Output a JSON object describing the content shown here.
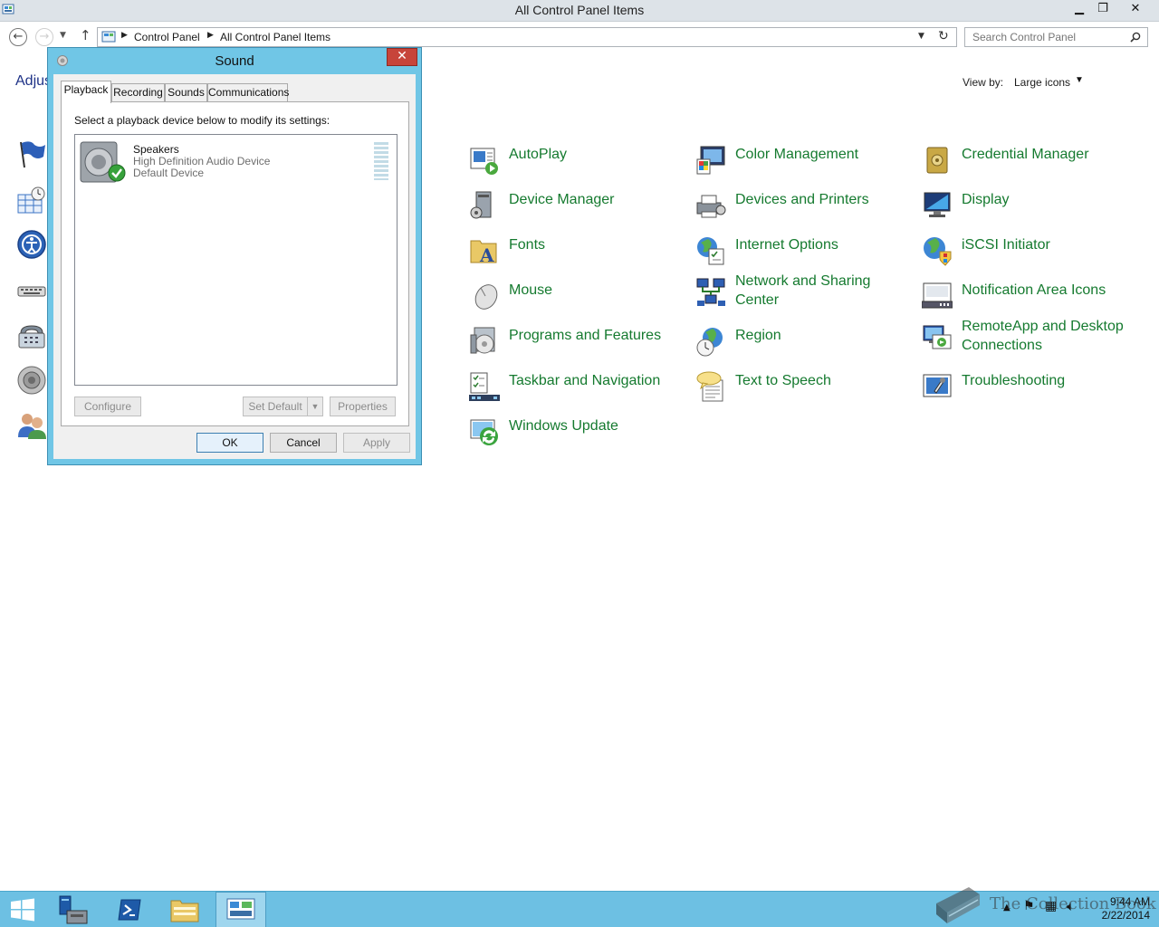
{
  "window": {
    "title": "All Control Panel Items",
    "controls": {
      "minimize": "▁",
      "restore": "❐",
      "close": "✕"
    }
  },
  "address_bar": {
    "breadcrumbs": [
      "Control Panel",
      "All Control Panel Items"
    ]
  },
  "search": {
    "placeholder": "Search Control Panel"
  },
  "content": {
    "heading": "Adjus",
    "view_by": {
      "label": "View by:",
      "value": "Large icons"
    },
    "items": [
      {
        "label": "AutoPlay",
        "icon": "autoplay-icon"
      },
      {
        "label": "Color Management",
        "icon": "color-management-icon"
      },
      {
        "label": "Credential Manager",
        "icon": "credential-manager-icon"
      },
      {
        "label": "Device Manager",
        "icon": "device-manager-icon"
      },
      {
        "label": "Devices and Printers",
        "icon": "devices-printers-icon"
      },
      {
        "label": "Display",
        "icon": "display-icon"
      },
      {
        "label": "Fonts",
        "icon": "fonts-icon"
      },
      {
        "label": "Internet Options",
        "icon": "internet-options-icon"
      },
      {
        "label": "iSCSI Initiator",
        "icon": "iscsi-icon"
      },
      {
        "label": "Mouse",
        "icon": "mouse-icon"
      },
      {
        "label": "Network and Sharing Center",
        "icon": "network-icon"
      },
      {
        "label": "Notification Area Icons",
        "icon": "notification-icon"
      },
      {
        "label": "Programs and Features",
        "icon": "programs-icon"
      },
      {
        "label": "Region",
        "icon": "region-icon"
      },
      {
        "label": "RemoteApp and Desktop Connections",
        "icon": "remoteapp-icon"
      },
      {
        "label": "Taskbar and Navigation",
        "icon": "taskbar-nav-icon"
      },
      {
        "label": "Text to Speech",
        "icon": "text-to-speech-icon"
      },
      {
        "label": "Troubleshooting",
        "icon": "troubleshooting-icon"
      },
      {
        "label": "Windows Update",
        "icon": "windows-update-icon"
      }
    ]
  },
  "sound_dialog": {
    "title": "Sound",
    "close": "✕",
    "tabs": [
      "Playback",
      "Recording",
      "Sounds",
      "Communications"
    ],
    "active_tab": "Playback",
    "instructions": "Select a playback device below to modify its settings:",
    "device": {
      "name": "Speakers",
      "description": "High Definition Audio Device",
      "status": "Default Device"
    },
    "buttons": {
      "configure": "Configure",
      "set_default": "Set Default",
      "properties": "Properties",
      "ok": "OK",
      "cancel": "Cancel",
      "apply": "Apply"
    }
  },
  "taskbar": {
    "items": [
      "start-icon",
      "server-manager-icon",
      "powershell-icon",
      "file-explorer-icon",
      "control-panel-icon"
    ],
    "time": "9:44 AM",
    "date": "2/22/2014"
  },
  "watermark": {
    "text": "The Collection Book"
  },
  "colors": {
    "link_green": "#157a2f",
    "heading_blue": "#1e3287",
    "dialog_frame": "#70c6e6",
    "taskbar": "#6dc0e3",
    "close_red": "#c7443a"
  }
}
